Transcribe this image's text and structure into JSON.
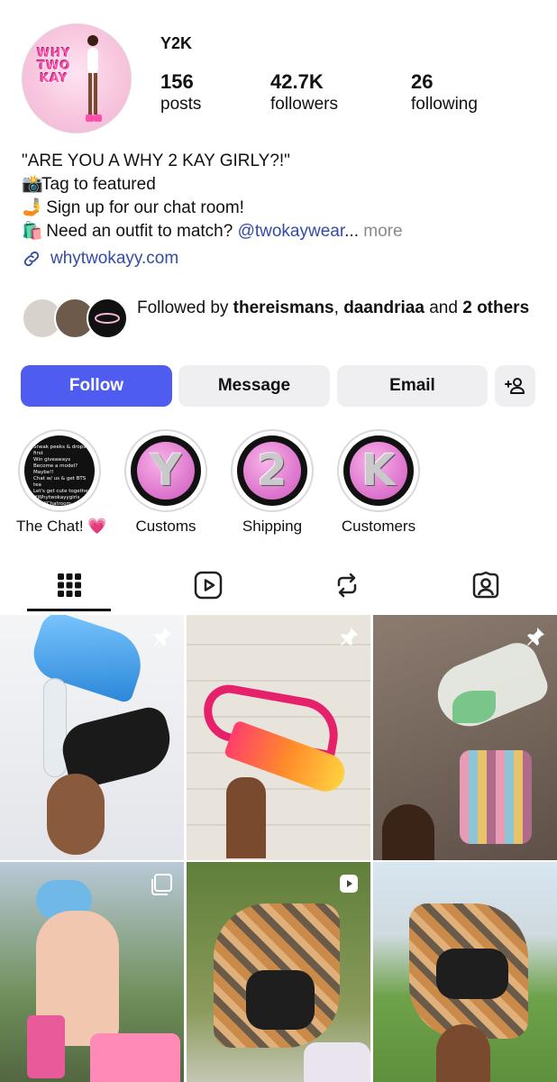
{
  "profile": {
    "username": "Y2K",
    "avatar_logo": "WHY TWO KAY",
    "stats": [
      {
        "value": "156",
        "label": "posts"
      },
      {
        "value": "42.7K",
        "label": "followers"
      },
      {
        "value": "26",
        "label": "following"
      }
    ]
  },
  "bio": {
    "line1": "\"ARE YOU A WHY 2 KAY GIRLY?!\"",
    "line2_emoji": "📸",
    "line2": "Tag to featured",
    "line3_emoji": "🤳",
    "line3": " Sign up for our chat room!",
    "line4_emoji": "🛍️",
    "line4": " Need an outfit to match? ",
    "mention": "@twokaywear",
    "ellipsis": "...",
    "more": " more",
    "link_icon": "link-icon",
    "link": "whytwokayy.com"
  },
  "followed_by": {
    "prefix": "Followed by ",
    "name1": "thereismans",
    "sep": ", ",
    "name2": "daandriaa",
    "and": " and ",
    "count": "2 others"
  },
  "actions": {
    "follow": "Follow",
    "message": "Message",
    "email": "Email",
    "add_person_icon": "add-person-icon"
  },
  "highlights": [
    {
      "label": "The Chat! 💗",
      "cover_text": "Sneak peeks & drops first\nWin giveaways\nBecome a model?\nMaybe!!\nChat w/ us & get BTS tea\nLet's get cute together\n#Whytwokayygirls\n#Y2KChatroom"
    },
    {
      "label": "Customs",
      "letter": "Y"
    },
    {
      "label": "Shipping",
      "letter": "2"
    },
    {
      "label": "Customers",
      "letter": "K"
    }
  ],
  "tabs": [
    {
      "icon": "grid-icon",
      "active": true
    },
    {
      "icon": "reels-icon",
      "active": false
    },
    {
      "icon": "repost-icon",
      "active": false
    },
    {
      "icon": "tagged-icon",
      "active": false
    }
  ],
  "posts": [
    {
      "badge": "pin-icon",
      "pinned": true
    },
    {
      "badge": "pin-icon",
      "pinned": true
    },
    {
      "badge": "pin-icon",
      "pinned": true
    },
    {
      "badge": "carousel-icon",
      "pinned": false
    },
    {
      "badge": "reel-icon",
      "pinned": false
    },
    {
      "badge": "",
      "pinned": false
    }
  ],
  "colors": {
    "accent": "#4f5cf0",
    "link": "#344aa8",
    "button_bg": "#efeff2"
  }
}
